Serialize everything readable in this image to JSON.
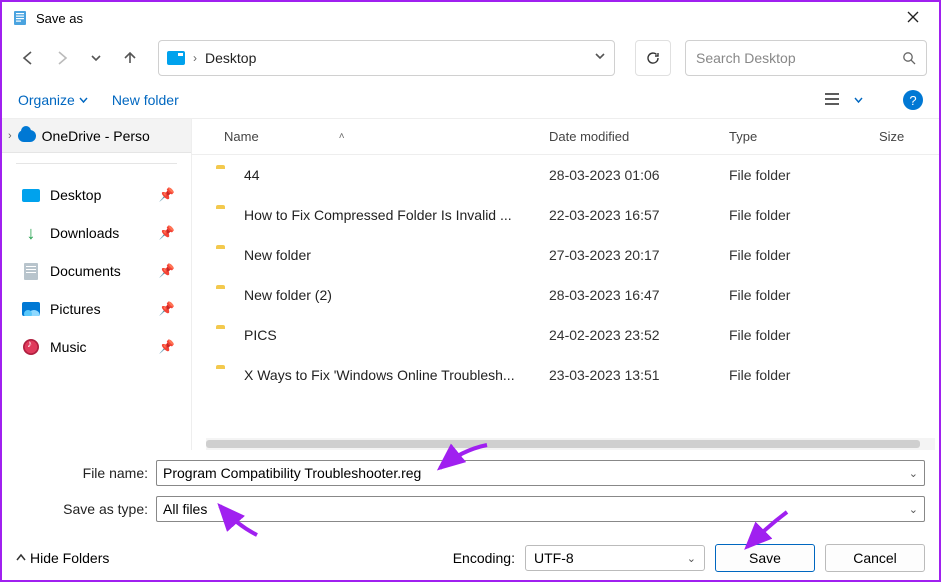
{
  "title": "Save as",
  "breadcrumb": {
    "location": "Desktop"
  },
  "search": {
    "placeholder": "Search Desktop"
  },
  "toolbar": {
    "organize": "Organize",
    "new_folder": "New folder"
  },
  "sidebar": {
    "top": "OneDrive - Perso",
    "items": [
      {
        "label": "Desktop"
      },
      {
        "label": "Downloads"
      },
      {
        "label": "Documents"
      },
      {
        "label": "Pictures"
      },
      {
        "label": "Music"
      }
    ]
  },
  "columns": {
    "name": "Name",
    "date": "Date modified",
    "type": "Type",
    "size": "Size"
  },
  "files": [
    {
      "name": "44",
      "date": "28-03-2023 01:06",
      "type": "File folder"
    },
    {
      "name": "How to Fix Compressed Folder Is Invalid ...",
      "date": "22-03-2023 16:57",
      "type": "File folder"
    },
    {
      "name": "New folder",
      "date": "27-03-2023 20:17",
      "type": "File folder"
    },
    {
      "name": "New folder (2)",
      "date": "28-03-2023 16:47",
      "type": "File folder"
    },
    {
      "name": "PICS",
      "date": "24-02-2023 23:52",
      "type": "File folder"
    },
    {
      "name": "X Ways to Fix 'Windows Online Troublesh...",
      "date": "23-03-2023 13:51",
      "type": "File folder"
    }
  ],
  "form": {
    "filename_label": "File name:",
    "filename_value": "Program Compatibility Troubleshooter.reg",
    "savetype_label": "Save as type:",
    "savetype_value": "All files"
  },
  "footer": {
    "hide_folders": "Hide Folders",
    "encoding_label": "Encoding:",
    "encoding_value": "UTF-8",
    "save": "Save",
    "cancel": "Cancel"
  }
}
